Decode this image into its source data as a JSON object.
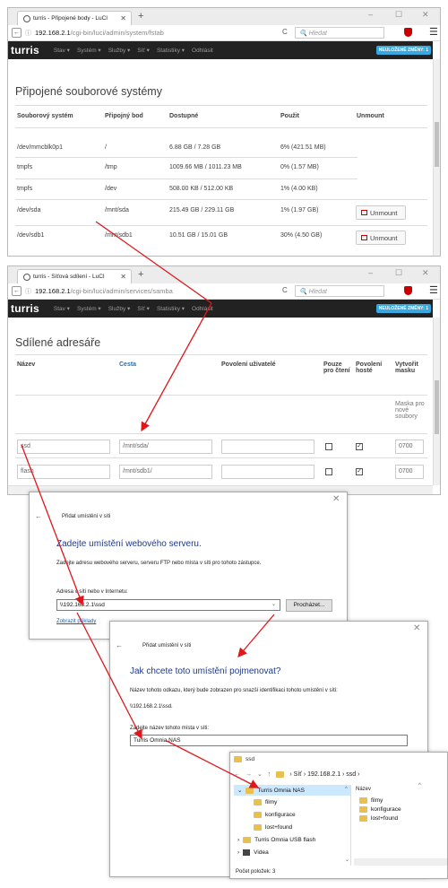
{
  "colors": {
    "accent": "#e0161b",
    "luci_bg": "#222222",
    "unsaved": "#3aa8e0",
    "dialog_heading": "#1e3a8a",
    "folder": "#e8c050"
  },
  "browser1": {
    "tab_title": "turris - Připojené body - LuCI",
    "url_host": "192.168.2.1",
    "url_path": "/cgi-bin/luci/admin/system/fstab",
    "search_placeholder": "Hledat",
    "logo": "turris",
    "menu": [
      "Stav ▾",
      "Systém ▾",
      "Služby ▾",
      "Síť ▾",
      "Statistiky ▾",
      "Odhlásit"
    ],
    "unsaved": "NEULOŽENÉ ZMĚNY: 1",
    "page_title": "Připojené souborové systémy",
    "headers": [
      "Souborový systém",
      "Připojný bod",
      "Dostupné",
      "Použit",
      "Unmount"
    ],
    "rows": [
      {
        "fs": "/dev/mmcblk0p1",
        "mp": "/",
        "avail": "6.88 GB / 7.28 GB",
        "used": "6% (421.51 MB)",
        "unmount": ""
      },
      {
        "fs": "tmpfs",
        "mp": "/tmp",
        "avail": "1009.66 MB / 1011.23 MB",
        "used": "0% (1.57 MB)",
        "unmount": ""
      },
      {
        "fs": "tmpfs",
        "mp": "/dev",
        "avail": "508.00 KB / 512.00 KB",
        "used": "1% (4.00 KB)",
        "unmount": ""
      },
      {
        "fs": "/dev/sda",
        "mp": "/mnt/sda",
        "avail": "215.49 GB / 229.11 GB",
        "used": "1% (1.97 GB)",
        "unmount": "Unmount"
      },
      {
        "fs": "/dev/sdb1",
        "mp": "/mnt/sdb1",
        "avail": "10.51 GB / 15.01 GB",
        "used": "30% (4.50 GB)",
        "unmount": "Unmount"
      }
    ]
  },
  "browser2": {
    "tab_title": "turris - Síťová sdílení - LuCI",
    "url_host": "192.168.2.1",
    "url_path": "/cgi-bin/luci/admin/services/samba",
    "search_placeholder": "Hledat",
    "logo": "turris",
    "menu": [
      "Stav ▾",
      "Systém ▾",
      "Služby ▾",
      "Síť ▾",
      "Statistiky ▾",
      "Odhlásit"
    ],
    "unsaved": "NEULOŽENÉ ZMĚNY: 1",
    "page_title": "Sdílené adresáře",
    "headers": {
      "name": "Název",
      "path": "Cesta",
      "perm": "Povolení uživatelé",
      "ro": "Pouze pro čtení",
      "guest": "Povolení hosté",
      "mask": "Vytvořit masku"
    },
    "mask_note": "Maska pro nové soubory",
    "rows": [
      {
        "name": "ssd",
        "path": "/mnt/sda/",
        "perm": "",
        "ro": false,
        "guest": true,
        "mask": "0700"
      },
      {
        "name": "flash",
        "path": "/mnt/sdb1/",
        "perm": "",
        "ro": false,
        "guest": true,
        "mask": "0700"
      }
    ]
  },
  "dialog1": {
    "title": "Přidat umístění v síti",
    "heading": "Zadejte umístění webového serveru.",
    "text": "Zadejte adresu webového serveru, serveru FTP nebo místa v síti pro tohoto zástupce.",
    "label": "Adresa v síti nebo v Internetu:",
    "value": "\\\\192.168.2.1\\ssd",
    "browse": "Procházet...",
    "link": "Zobrazit příklady"
  },
  "dialog2": {
    "title": "Přidat umístění v síti",
    "heading": "Jak chcete toto umístění pojmenovat?",
    "text": "Název tohoto odkazu, který bude zobrazen pro snazší identifikaci tohoto umístění v síti:",
    "path": "\\\\192.168.2.1\\ssd.",
    "label": "Zadejte název tohoto místa v síti:",
    "value": "Turris Omnia NAS"
  },
  "explorer": {
    "title": "ssd",
    "breadcrumb": "›  Síť  ›  192.168.2.1  ›  ssd  ›",
    "tree": [
      {
        "label": "Turris Omnia NAS",
        "level": 0,
        "selected": true
      },
      {
        "label": "filmy",
        "level": 1
      },
      {
        "label": "konfigurace",
        "level": 1
      },
      {
        "label": "lost+found",
        "level": 1
      },
      {
        "label": "Turris Omnia USB flash",
        "level": 0
      },
      {
        "label": "Videa",
        "level": 0
      }
    ],
    "column_header": "Název",
    "items": [
      "filmy",
      "konfigurace",
      "lost+found"
    ],
    "status": "Počet položek: 3"
  }
}
